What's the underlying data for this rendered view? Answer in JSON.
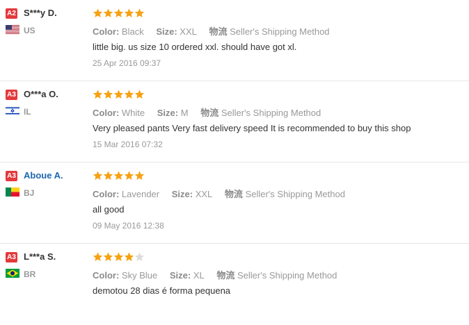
{
  "reviews": [
    {
      "badge": "A2",
      "name": "S***y D.",
      "name_is_link": false,
      "country": "US",
      "flag": "us-flag",
      "rating": 5,
      "color_label": "Color:",
      "color_value": "Black",
      "size_label": "Size:",
      "size_value": "XXL",
      "shipping_label": "物流",
      "shipping_value": "Seller's Shipping Method",
      "text": "little big. us size 10 ordered xxl. should have got xl.",
      "date": "25 Apr 2016 09:37"
    },
    {
      "badge": "A3",
      "name": "O***a O.",
      "name_is_link": false,
      "country": "IL",
      "flag": "il-flag",
      "rating": 5,
      "color_label": "Color:",
      "color_value": "White",
      "size_label": "Size:",
      "size_value": "M",
      "shipping_label": "物流",
      "shipping_value": "Seller's Shipping Method",
      "text": "Very pleased pants Very fast delivery speed It is recommended to buy this shop",
      "date": "15 Mar 2016 07:32"
    },
    {
      "badge": "A3",
      "name": "Aboue A.",
      "name_is_link": true,
      "country": "BJ",
      "flag": "bj-flag",
      "rating": 5,
      "color_label": "Color:",
      "color_value": "Lavender",
      "size_label": "Size:",
      "size_value": "XXL",
      "shipping_label": "物流",
      "shipping_value": "Seller's Shipping Method",
      "text": "all good",
      "date": "09 May 2016 12:38"
    },
    {
      "badge": "A3",
      "name": "L***a S.",
      "name_is_link": false,
      "country": "BR",
      "flag": "br-flag",
      "rating": 4,
      "color_label": "Color:",
      "color_value": "Sky Blue",
      "size_label": "Size:",
      "size_value": "XL",
      "shipping_label": "物流",
      "shipping_value": "Seller's Shipping Method",
      "text": "demotou 28 dias é forma pequena",
      "date": ""
    }
  ],
  "max_rating": 5,
  "colors": {
    "badge": "#e4393c",
    "star_filled": "#f7a112",
    "star_empty": "#dddddd",
    "link": "#1a66b0"
  }
}
